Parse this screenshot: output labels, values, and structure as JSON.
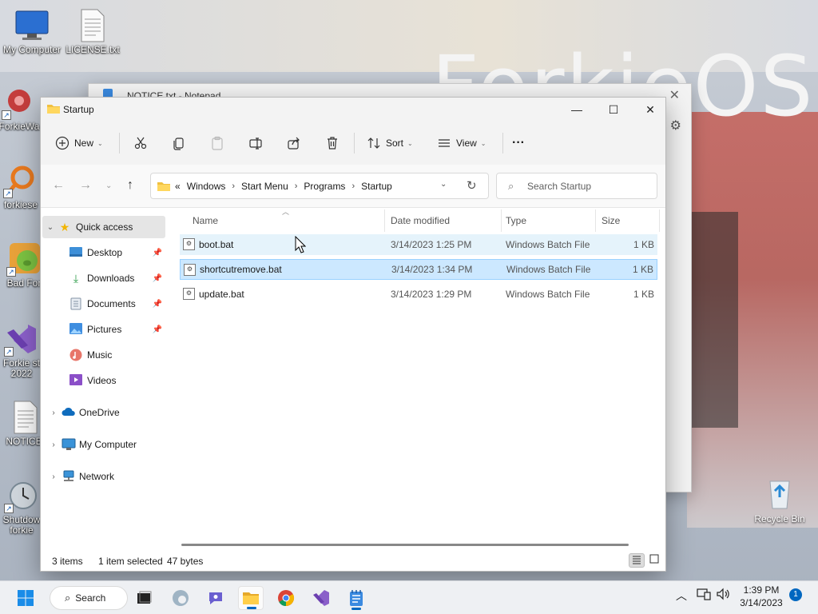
{
  "desktop": {
    "brand": "ForkieOS",
    "icons": [
      {
        "label": "My Computer"
      },
      {
        "label": "LICENSE.txt"
      },
      {
        "label": "ForkieWa"
      },
      {
        "label": "forkiese"
      },
      {
        "label": "Bad For"
      },
      {
        "label": "Forkie st 2022"
      },
      {
        "label": "NOTICE"
      },
      {
        "label": "Shutdow forkie"
      }
    ],
    "recycle_bin": "Recycle Bin"
  },
  "notepad": {
    "title": "NOTICE.txt - Notepad"
  },
  "explorer": {
    "title": "Startup",
    "window_controls": {
      "minimize": "—",
      "maximize": "☐",
      "close": "✕"
    },
    "commands": {
      "new": "New",
      "sort": "Sort",
      "view": "View",
      "more": "···"
    },
    "breadcrumb": {
      "overflow": "«",
      "items": [
        "Windows",
        "Start Menu",
        "Programs",
        "Startup"
      ]
    },
    "search": {
      "placeholder": "Search Startup"
    },
    "sidebar": {
      "items": [
        {
          "label": "Quick access"
        },
        {
          "label": "Desktop"
        },
        {
          "label": "Downloads"
        },
        {
          "label": "Documents"
        },
        {
          "label": "Pictures"
        },
        {
          "label": "Music"
        },
        {
          "label": "Videos"
        },
        {
          "label": "OneDrive"
        },
        {
          "label": "My Computer"
        },
        {
          "label": "Network"
        }
      ]
    },
    "columns": {
      "name": "Name",
      "date": "Date modified",
      "type": "Type",
      "size": "Size"
    },
    "files": [
      {
        "name": "boot.bat",
        "date": "3/14/2023 1:25 PM",
        "type": "Windows Batch File",
        "size": "1 KB"
      },
      {
        "name": "shortcutremove.bat",
        "date": "3/14/2023 1:34 PM",
        "type": "Windows Batch File",
        "size": "1 KB"
      },
      {
        "name": "update.bat",
        "date": "3/14/2023 1:29 PM",
        "type": "Windows Batch File",
        "size": "1 KB"
      }
    ],
    "status": {
      "count": "3 items",
      "selection": "1 item selected",
      "bytes": "47 bytes"
    }
  },
  "taskbar": {
    "search_label": "Search",
    "time": "1:39 PM",
    "date": "3/14/2023",
    "notifications": "1"
  },
  "colors": {
    "accent": "#0067c0",
    "selection": "#cce8ff",
    "hover": "#e5f3fb"
  }
}
